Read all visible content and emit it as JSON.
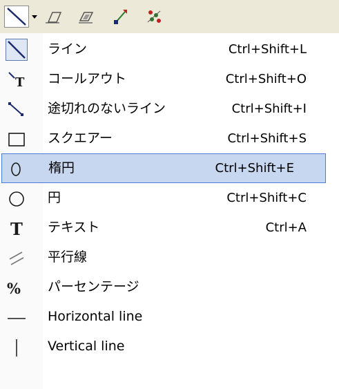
{
  "toolbar": {
    "icons": [
      "line-tool-icon",
      "dropdown-arrow-icon",
      "eraser-icon",
      "stamp-icon",
      "connector-icon",
      "sparkle-icon"
    ]
  },
  "menu": {
    "items": [
      {
        "label": "ライン",
        "shortcut": "Ctrl+Shift+L",
        "icon": "diagonal-line-icon"
      },
      {
        "label": "コールアウト",
        "shortcut": "Ctrl+Shift+O",
        "icon": "callout-icon"
      },
      {
        "label": "途切れのないライン",
        "shortcut": "Ctrl+Shift+I",
        "icon": "continuous-line-icon"
      },
      {
        "label": "スクエアー",
        "shortcut": "Ctrl+Shift+S",
        "icon": "square-icon"
      },
      {
        "label": "楕円",
        "shortcut": "Ctrl+Shift+E",
        "icon": "ellipse-icon",
        "highlighted": true
      },
      {
        "label": "円",
        "shortcut": "Ctrl+Shift+C",
        "icon": "circle-icon"
      },
      {
        "label": "テキスト",
        "shortcut": "Ctrl+A",
        "icon": "text-icon"
      },
      {
        "label": "平行線",
        "shortcut": "",
        "icon": "parallel-lines-icon"
      },
      {
        "label": "パーセンテージ",
        "shortcut": "",
        "icon": "percent-icon"
      },
      {
        "label": "Horizontal line",
        "shortcut": "",
        "icon": "horizontal-line-icon"
      },
      {
        "label": "Vertical line",
        "shortcut": "",
        "icon": "vertical-line-icon"
      }
    ]
  },
  "colors": {
    "toolbar_bg": "#ece9d8",
    "highlight_bg": "#c7d7f0",
    "highlight_border": "#4a7bd6",
    "icon_blue": "#1a2a6e"
  }
}
